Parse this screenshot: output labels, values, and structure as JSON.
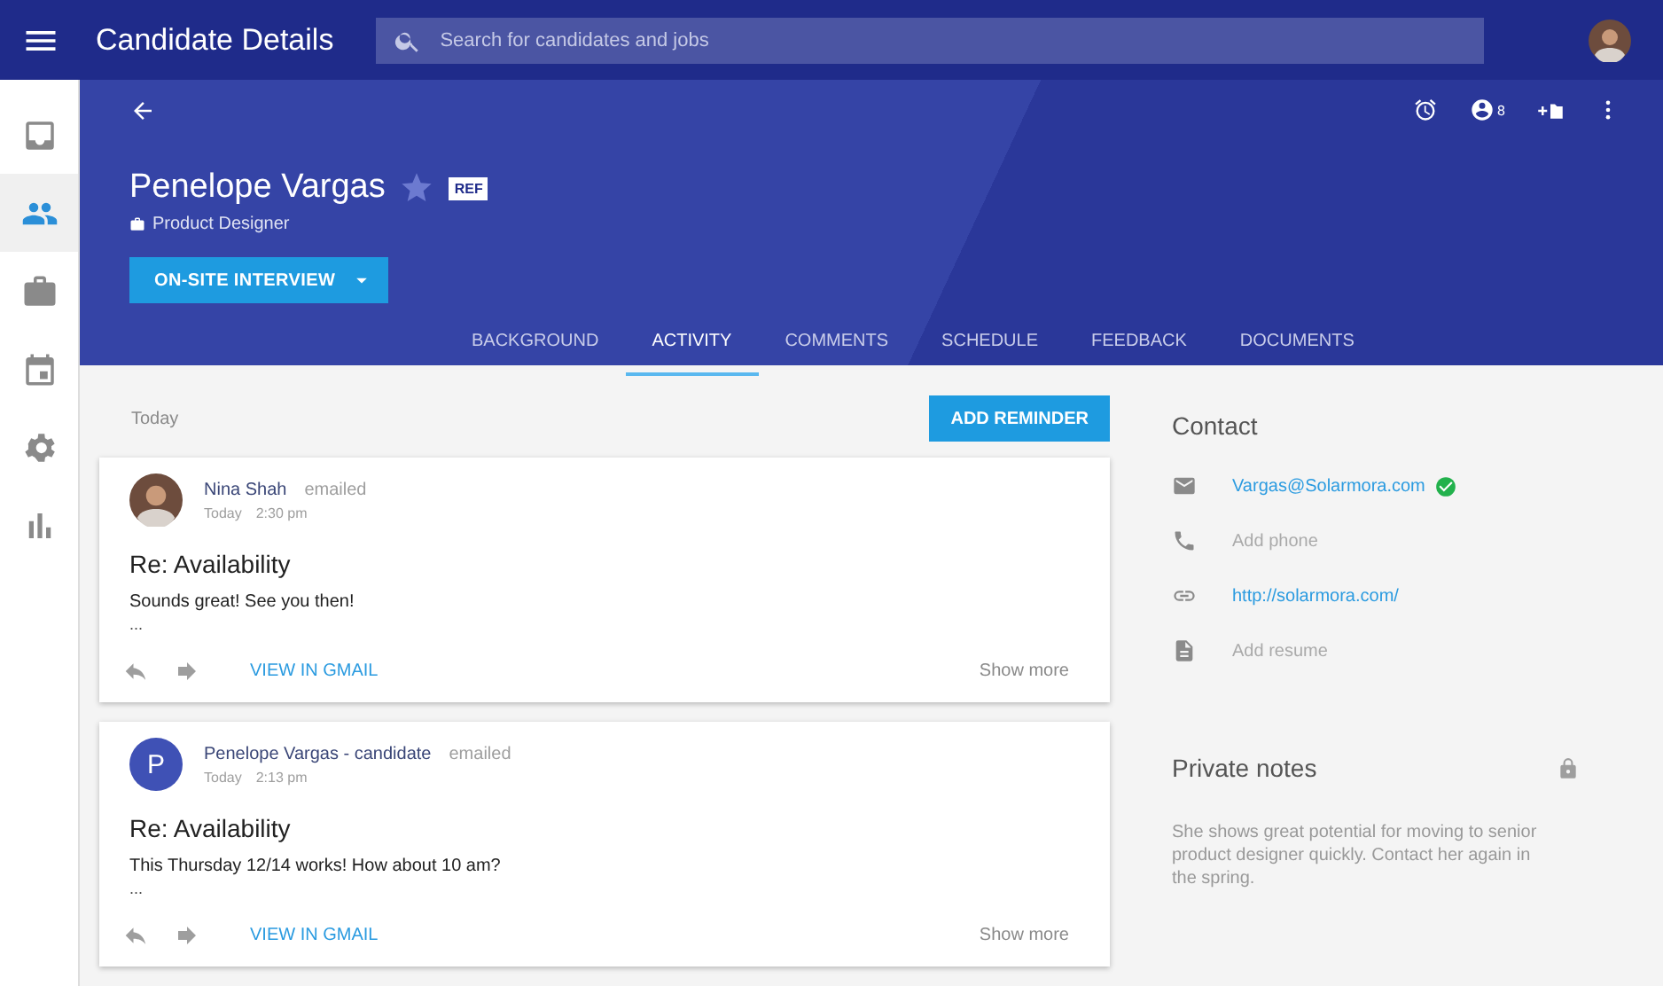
{
  "app_bar": {
    "title": "Candidate Details",
    "search": {
      "placeholder": "Search for candidates and jobs"
    }
  },
  "nav": [
    {
      "kind": "inbox",
      "selected": false
    },
    {
      "kind": "people",
      "selected": true
    },
    {
      "kind": "briefcase",
      "selected": false
    },
    {
      "kind": "calendar",
      "selected": false
    },
    {
      "kind": "settings",
      "selected": false
    },
    {
      "kind": "chart",
      "selected": false
    }
  ],
  "candidate": {
    "name": "Penelope Vargas",
    "starred": false,
    "badge": "REF",
    "role": "Product Designer",
    "stage_button": "ON-SITE INTERVIEW",
    "watchers": "8"
  },
  "tabs": [
    {
      "label": "BACKGROUND",
      "selected": false
    },
    {
      "label": "ACTIVITY",
      "selected": true
    },
    {
      "label": "COMMENTS",
      "selected": false
    },
    {
      "label": "SCHEDULE",
      "selected": false
    },
    {
      "label": "FEEDBACK",
      "selected": false
    },
    {
      "label": "DOCUMENTS",
      "selected": false
    }
  ],
  "activity": {
    "date": "Today",
    "add_button": "ADD REMINDER",
    "entries": [
      {
        "kind": "photo",
        "sender": "Nina Shah",
        "action": "emailed",
        "day": "Today",
        "time": "2:30 pm",
        "subject": "Re: Availability",
        "body": "Sounds great! See you then!",
        "ellipsis": "...",
        "link": "VIEW IN GMAIL",
        "more": "Show more"
      },
      {
        "kind": "letter",
        "initial": "P",
        "sender": "Penelope Vargas - candidate",
        "action": "emailed",
        "day": "Today",
        "time": "2:13 pm",
        "subject": "Re: Availability",
        "body": "This Thursday 12/14 works! How about 10 am?",
        "ellipsis": "...",
        "link": "VIEW IN GMAIL",
        "more": "Show more"
      }
    ]
  },
  "contact": {
    "title": "Contact",
    "items": [
      {
        "kind": "email",
        "text": "Vargas@Solarmora.com",
        "linked": true,
        "verified": true
      },
      {
        "kind": "phone",
        "text": "Add phone",
        "linked": false,
        "verified": false
      },
      {
        "kind": "link",
        "text": "http://solarmora.com/",
        "linked": true,
        "verified": false
      },
      {
        "kind": "resume",
        "text": "Add resume",
        "linked": false,
        "verified": false
      }
    ]
  },
  "notes": {
    "title": "Private notes",
    "locked": true,
    "text": "She shows great potential for moving to senior product designer quickly. Contact her again in the spring."
  }
}
